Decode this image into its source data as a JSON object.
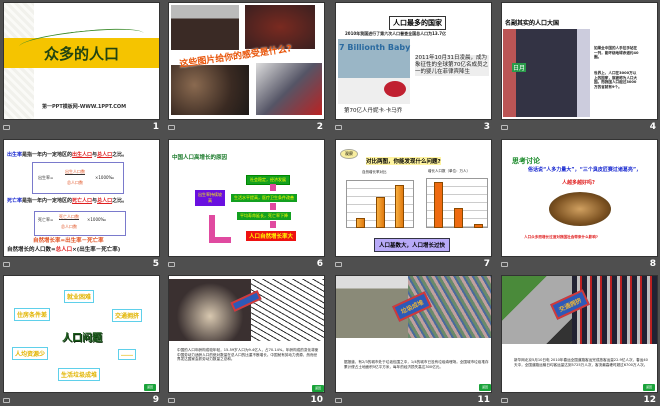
{
  "slides": [
    {
      "number": "1",
      "title": "众多的人口",
      "footer": "第一PPT模板网-WWW.1PPT.COM"
    },
    {
      "number": "2",
      "banner": "这些图片给你的感受是什么?"
    },
    {
      "number": "3",
      "title": "人口最多的国家",
      "subtitle": "2010年我国进行了第六次人口普查全国总人口为13.7亿",
      "photo_caption": "7 Billionth Baby",
      "text": "2011年10月31日凌晨，成为象征性的全球第70亿名成员之一的婴儿在菲律宾降生",
      "footer": "第70亿人丹妮卡·卡马乔"
    },
    {
      "number": "4",
      "title": "名副其实的人口大国",
      "sign": "日月",
      "p1": "如果全中国的人手拉手站在一列，能环绕地球赤道约40圈。",
      "p2": "世界上，人口在3000万以上的国家，就被称为人口大国。而我国人口超过3000万的省就有9个。"
    },
    {
      "number": "5",
      "l1a": "出生率",
      "l1b": "是指一年内一定地区的",
      "l1c": "出生人口",
      "l1d": "与",
      "l1e": "总人口",
      "l1f": "之比。",
      "f1label": "出生率=",
      "f1num": "出生人口数",
      "f1den": "总人口数",
      "f1mult": "×1000‰",
      "l2a": "死亡率",
      "l2b": "是指一年内一定地区的",
      "l2c": "死亡人口",
      "l2d": "与",
      "l2e": "总人口",
      "l2f": "之比。",
      "f2label": "死亡率=",
      "f2num": "死亡人口数",
      "f2den": "总人口数",
      "f2mult": "×1000‰",
      "l3": "自然增长率=出生率－死亡率",
      "l4a": "自然增长的人口数=",
      "l4b": "总人口",
      "l4c": "×(出生率－死亡率)"
    },
    {
      "number": "6",
      "title": "中国人口高增长的原因",
      "left": "出生率持续较高",
      "b1": "社会稳定，经济发展",
      "b2": "生活水平提高，医疗卫生条件改善",
      "b3": "平均寿命延长，死亡率下降",
      "result": "人口自然增长率大"
    },
    {
      "number": "7",
      "tag": "观察",
      "question": "对比两图，你能发现什么问题?",
      "chart1_title": "自然增长率对比",
      "chart2_title": "增长人口数（单位：万人）",
      "conclusion": "人口基数大，人口增长过快"
    },
    {
      "number": "8",
      "title": "思考讨论",
      "q1": "俗话说“人多力量大”，“三个臭皮匠赛过诸葛亮”，",
      "q2": "人越多越好吗?",
      "bottom": "人口众多而增长过速对我国社会带来什么影响?"
    },
    {
      "number": "9",
      "center": "人口问题",
      "items": [
        "就业困难",
        "住房条件差",
        "交通拥挤",
        "人均资源少",
        "……",
        "生活垃圾成堆"
      ],
      "btn": "返回"
    },
    {
      "number": "10",
      "text": "中国的人口年龄构成较年轻，15-59岁人口为9.4亿人，占70.14%。年龄构成的变化将使中国劳动力适龄人口的绝对数量在总人口的比重不断增长。中国就有劳动力资源，然而世界发达国家会抓劳动力数量之总和。",
      "btn": "返回"
    },
    {
      "number": "11",
      "stamp": "垃圾成堆",
      "text": "据报道，有2/3的城市处于垃圾包围之中，1/4的城市已没有垃圾填埋场。全国城市垃圾堆存累计侵占土地面积5亿平方米，每年的经济损失高达300亿元。",
      "btn": "返回"
    },
    {
      "number": "12",
      "stamp": "交通拥挤",
      "text": "新华网北京5月10日电 2010年春运全国道路客运完成旅客运量22.9亿人次，春运40天中，全国道路运输日均客运量达到5725万人次，客流最高峰时超过6700万人次。",
      "btn": "返回"
    }
  ]
}
